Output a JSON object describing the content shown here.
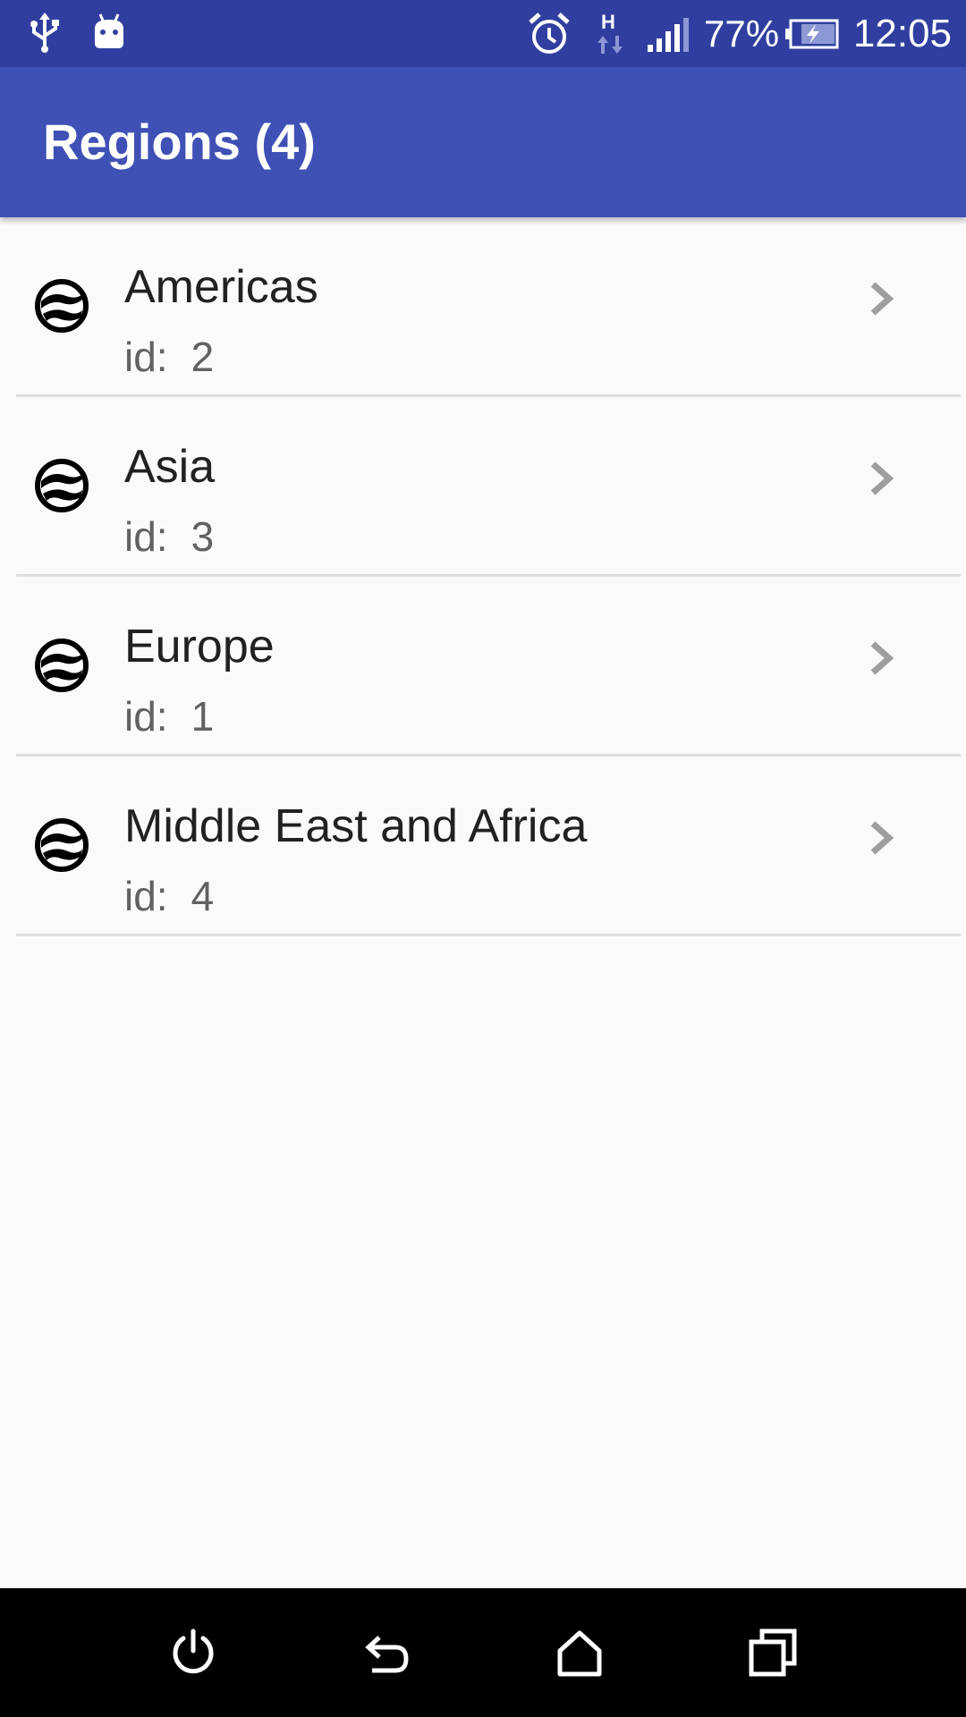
{
  "status_bar": {
    "icons": [
      "usb-icon",
      "android-debug-icon",
      "alarm-icon",
      "h-data-icon",
      "signal-icon",
      "battery-charging-icon"
    ],
    "battery_percent": "77%",
    "time": "12:05"
  },
  "app_bar": {
    "title": "Regions (4)"
  },
  "list": {
    "items": [
      {
        "title": "Americas",
        "id_label": "id:",
        "id_value": "2",
        "icon": "globe-icon",
        "trailing_icon": "chevron-right-icon"
      },
      {
        "title": "Asia",
        "id_label": "id:",
        "id_value": "3",
        "icon": "globe-icon",
        "trailing_icon": "chevron-right-icon"
      },
      {
        "title": "Europe",
        "id_label": "id:",
        "id_value": "1",
        "icon": "globe-icon",
        "trailing_icon": "chevron-right-icon"
      },
      {
        "title": "Middle East and Africa",
        "id_label": "id:",
        "id_value": "4",
        "icon": "globe-icon",
        "trailing_icon": "chevron-right-icon"
      }
    ]
  },
  "nav_bar": {
    "buttons": [
      "power-icon",
      "back-icon",
      "home-icon",
      "recent-apps-icon"
    ]
  },
  "colors": {
    "status_bar": "#303f9f",
    "app_bar": "#3f51b5",
    "background": "#fafafa",
    "nav_bar": "#000000"
  }
}
